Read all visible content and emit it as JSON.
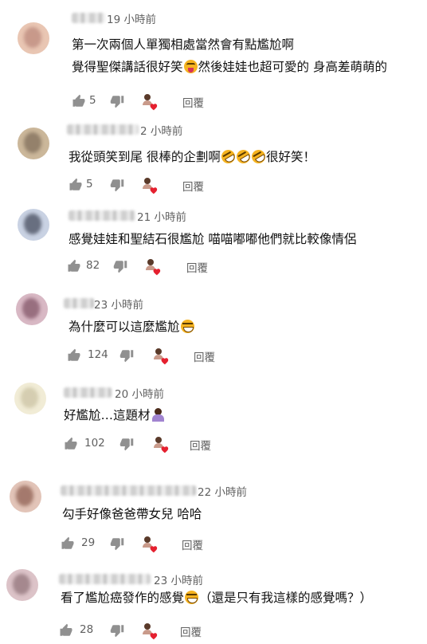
{
  "comments": [
    {
      "time": "19 小時前",
      "lines": [
        [
          {
            "t": "第一次兩個人單獨相處當然會有點尷尬啊"
          }
        ],
        [
          {
            "t": "覺得聖傑講話很好笑"
          },
          {
            "e": "tongue"
          },
          {
            "t": "然後娃娃也超可愛的 身高差萌萌的"
          }
        ]
      ],
      "likes": "5",
      "reply_label": "回覆",
      "avatar_colors": [
        "#e9c6b3",
        "#b9867a"
      ]
    },
    {
      "time": "2 小時前",
      "lines": [
        [
          {
            "t": "我從頭笑到尾 很棒的企劃啊"
          },
          {
            "e": "rofl"
          },
          {
            "e": "rofl"
          },
          {
            "e": "rofl"
          },
          {
            "t": "很好笑！"
          }
        ]
      ],
      "likes": "5",
      "reply_label": "回覆",
      "avatar_colors": [
        "#cbb79a",
        "#7c6a57"
      ]
    },
    {
      "time": "21 小時前",
      "lines": [
        [
          {
            "t": "感覺娃娃和聖結石很尷尬 喵喵嘟嘟他們就比較像情侶"
          }
        ]
      ],
      "likes": "82",
      "reply_label": "回覆",
      "avatar_colors": [
        "#c9d2e3",
        "#3f4556"
      ]
    },
    {
      "time": "23 小時前",
      "lines": [
        [
          {
            "t": "為什麼可以這麼尷尬"
          },
          {
            "e": "joy"
          }
        ]
      ],
      "likes": "124",
      "reply_label": "回覆",
      "avatar_colors": [
        "#d8b8c4",
        "#7e5063"
      ]
    },
    {
      "time": "20 小時前",
      "lines": [
        [
          {
            "t": "好尷尬…這題材"
          },
          {
            "e": "person"
          }
        ]
      ],
      "likes": "102",
      "reply_label": "回覆",
      "avatar_colors": [
        "#f1ecd6",
        "#c9c1a1"
      ]
    },
    {
      "time": "22 小時前",
      "lines": [
        [
          {
            "t": "勾手好像爸爸帶女兒  哈哈"
          }
        ]
      ],
      "likes": "29",
      "reply_label": "回覆",
      "avatar_colors": [
        "#e2c4b8",
        "#8b5b4d"
      ]
    },
    {
      "time": "23 小時前",
      "lines": [
        [
          {
            "t": "看了尷尬癌發作的感覺"
          },
          {
            "e": "joy"
          },
          {
            "t": "（還是只有我這樣的感覺嗎？）"
          }
        ]
      ],
      "likes": "28",
      "reply_label": "回覆",
      "avatar_colors": [
        "#dcc3c8",
        "#8d7076"
      ]
    }
  ],
  "icons": {
    "like": "thumbs-up-icon",
    "dislike": "thumbs-down-icon",
    "creator_heart": "creator-heart-icon"
  },
  "colors": {
    "muted_text": "#606060",
    "heart": "#e5202f"
  }
}
